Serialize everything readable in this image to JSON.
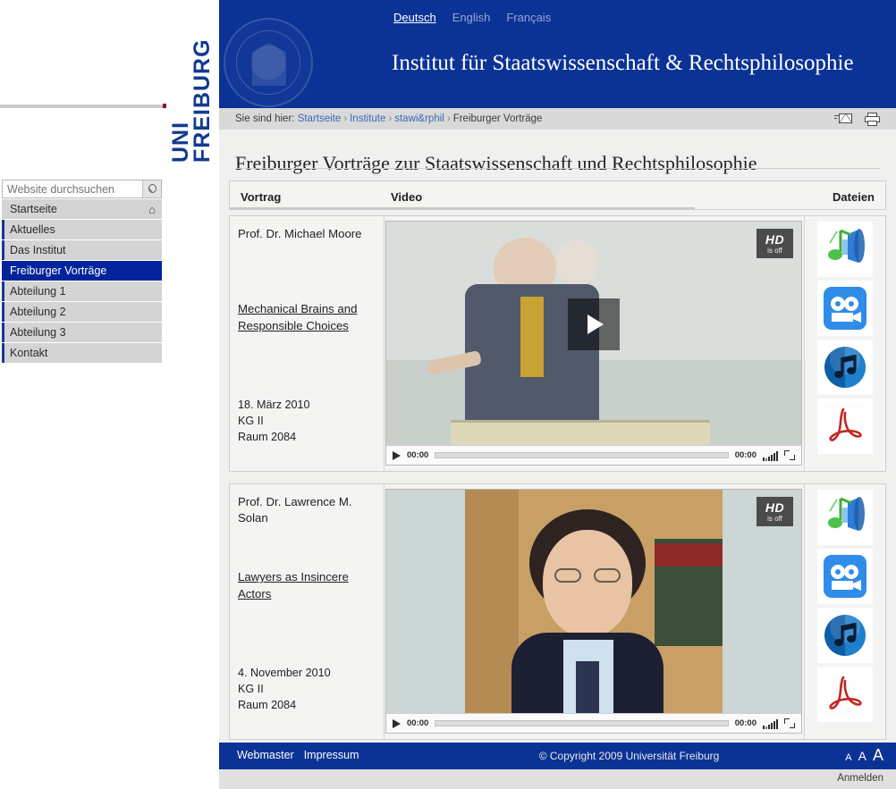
{
  "brand": {
    "logo_line1": "UNI",
    "logo_line2": "FREIBURG",
    "seal_name": "university-seal"
  },
  "languages": [
    {
      "label": "Deutsch",
      "active": true
    },
    {
      "label": "English",
      "active": false
    },
    {
      "label": "Français",
      "active": false
    }
  ],
  "header": {
    "site_title": "Institut für Staatswissenschaft & Rechtsphilosophie"
  },
  "breadcrumb": {
    "prefix": "Sie sind hier:",
    "items": [
      "Startseite",
      "Institute",
      "stawi&rphil",
      "Freiburger Vorträge"
    ],
    "separator": "›",
    "actions": [
      "mail-icon",
      "print-icon"
    ]
  },
  "page": {
    "title": "Freiburger Vorträge zur Staatswissenschaft und Rechtsphilosophie"
  },
  "search": {
    "placeholder": "Website durchsuchen",
    "value": "",
    "button_icon": "search-icon"
  },
  "sidebar": {
    "items": [
      {
        "label": "Startseite",
        "active": false,
        "icon": "home-icon"
      },
      {
        "label": "Aktuelles",
        "active": false
      },
      {
        "label": "Das Institut",
        "active": false
      },
      {
        "label": "Freiburger Vorträge",
        "active": true
      },
      {
        "label": "Abteilung 1",
        "active": false
      },
      {
        "label": "Abteilung 2",
        "active": false
      },
      {
        "label": "Abteilung 3",
        "active": false
      },
      {
        "label": "Kontakt",
        "active": false
      }
    ]
  },
  "table": {
    "columns": [
      "Vortrag",
      "Video",
      "Dateien"
    ],
    "rows": [
      {
        "speaker": "Prof. Dr. Michael Moore",
        "title": "Mechanical Brains and Responsible Choices",
        "date": "18. März 2010",
        "building": "KG II",
        "room": "Raum 2084",
        "player": {
          "hd_label": "HD",
          "hd_state": "is off",
          "current_time": "00:00",
          "duration": "00:00",
          "has_play_overlay": true,
          "controls": [
            "play-button",
            "scrubber",
            "volume-control",
            "fullscreen-button"
          ]
        },
        "files": [
          "audio-speaker-icon",
          "video-camera-icon",
          "mp3-music-icon",
          "pdf-icon"
        ]
      },
      {
        "speaker": "Prof. Dr. Lawrence M. Solan",
        "title": "Lawyers as Insincere Actors",
        "date": "4. November 2010",
        "building": "KG II",
        "room": "Raum 2084",
        "player": {
          "hd_label": "HD",
          "hd_state": "is off",
          "current_time": "00:00",
          "duration": "00:00",
          "has_play_overlay": false,
          "controls": [
            "play-button",
            "scrubber",
            "volume-control",
            "fullscreen-button"
          ]
        },
        "files": [
          "audio-speaker-icon",
          "video-camera-icon",
          "mp3-music-icon",
          "pdf-icon"
        ]
      }
    ]
  },
  "footer": {
    "links": [
      "Webmaster",
      "Impressum"
    ],
    "copyright": "© Copyright 2009 Universität Freiburg",
    "font_sizes": [
      "A",
      "A",
      "A"
    ],
    "login": "Anmelden"
  },
  "colors": {
    "brand_blue": "#0b3395",
    "nav_active": "#04239b",
    "accent_red": "#8c1230",
    "page_bg": "#f0f0ef"
  }
}
